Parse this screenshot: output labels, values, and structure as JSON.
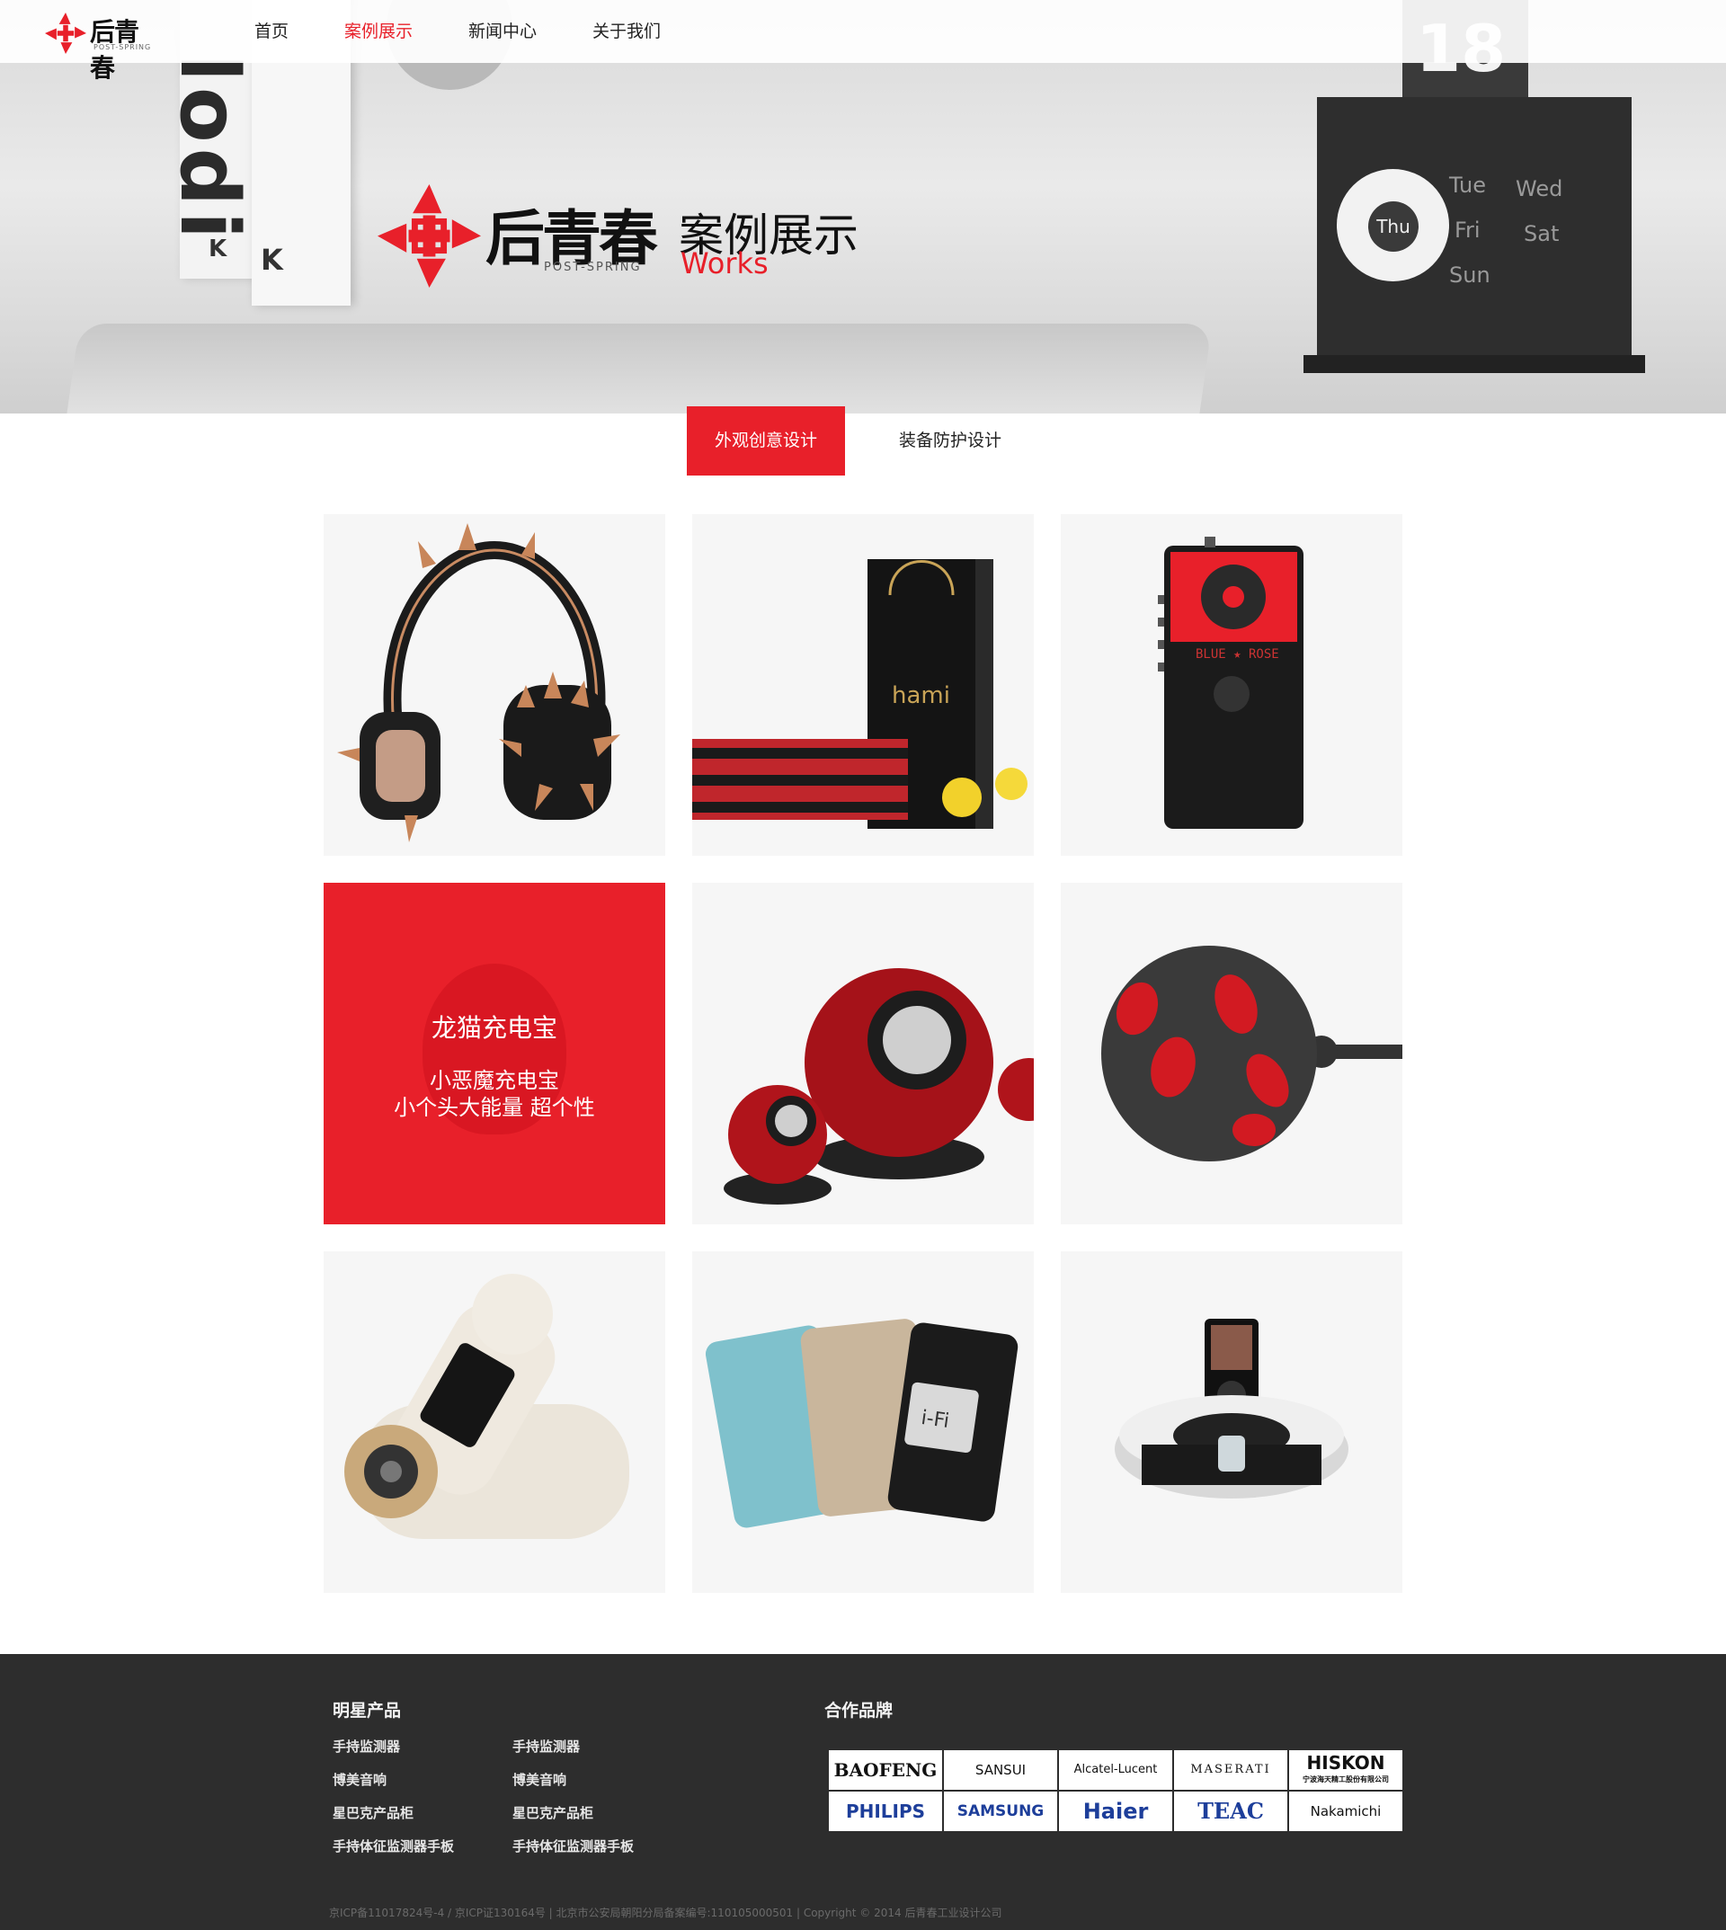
{
  "header": {
    "logo": {
      "cn": "后青春",
      "en": "POST-SPRING"
    },
    "nav": [
      {
        "label": "首页",
        "active": false
      },
      {
        "label": "案例展示",
        "active": true
      },
      {
        "label": "新闻中心",
        "active": false
      },
      {
        "label": "关于我们",
        "active": false
      }
    ]
  },
  "banner": {
    "logo_cn": "后青春",
    "logo_en": "POST-SPRING",
    "title_cn": "案例展示",
    "title_en": "Works",
    "decor": {
      "calendar_number": "18",
      "calendar_days": [
        "Tue",
        "Wed",
        "Thu",
        "Fri",
        "Sat",
        "Sun"
      ],
      "book_text": "lodi",
      "book_letters": [
        "K",
        "K"
      ]
    }
  },
  "tabs": [
    {
      "label": "外观创意设计",
      "active": true
    },
    {
      "label": "装备防护设计",
      "active": false
    }
  ],
  "works": [
    {
      "name": "headphones",
      "hover": false
    },
    {
      "name": "hami-packaging",
      "hover": false
    },
    {
      "name": "blue-rose-device",
      "hover": false,
      "print": {
        "brand": "BLUE ★ ROSE"
      }
    },
    {
      "name": "power-bank",
      "hover": true,
      "title": "龙猫充电宝",
      "subtitle_line1": "小恶魔充电宝",
      "subtitle_line2": "小个头大能量 超个性"
    },
    {
      "name": "speakers",
      "hover": false
    },
    {
      "name": "lips-device",
      "hover": false
    },
    {
      "name": "camera",
      "hover": false
    },
    {
      "name": "ifi-cases",
      "hover": false,
      "print": {
        "ifi": "i-Fi"
      }
    },
    {
      "name": "dock-speaker",
      "hover": false
    }
  ],
  "footer": {
    "products_title": "明星产品",
    "products_col1": [
      "手持监测器",
      "博美音响",
      "星巴克产品柜",
      "手持体征监测器手板"
    ],
    "products_col2": [
      "手持监测器",
      "博美音响",
      "星巴克产品柜",
      "手持体征监测器手板"
    ],
    "brands_title": "合作品牌",
    "brands": [
      "BAOFENG",
      "SANSUI",
      "Alcatel-Lucent",
      "MASERATI",
      "HISKON",
      "PHILIPS",
      "SAMSUNG",
      "Haier",
      "TEAC",
      "Nakamichi"
    ],
    "brand_sub": {
      "hiskon": "宁波海天精工股份有限公司"
    },
    "copyright": "京ICP备11017824号-4 / 京ICP证130164号    |    北京市公安局朝阳分局备案编号:110105000501    |    Copyright © 2014 后青春工业设计公司"
  },
  "colors": {
    "accent": "#e8202a",
    "footer_bg": "#2d2d2d",
    "card_bg": "#f6f6f6"
  }
}
